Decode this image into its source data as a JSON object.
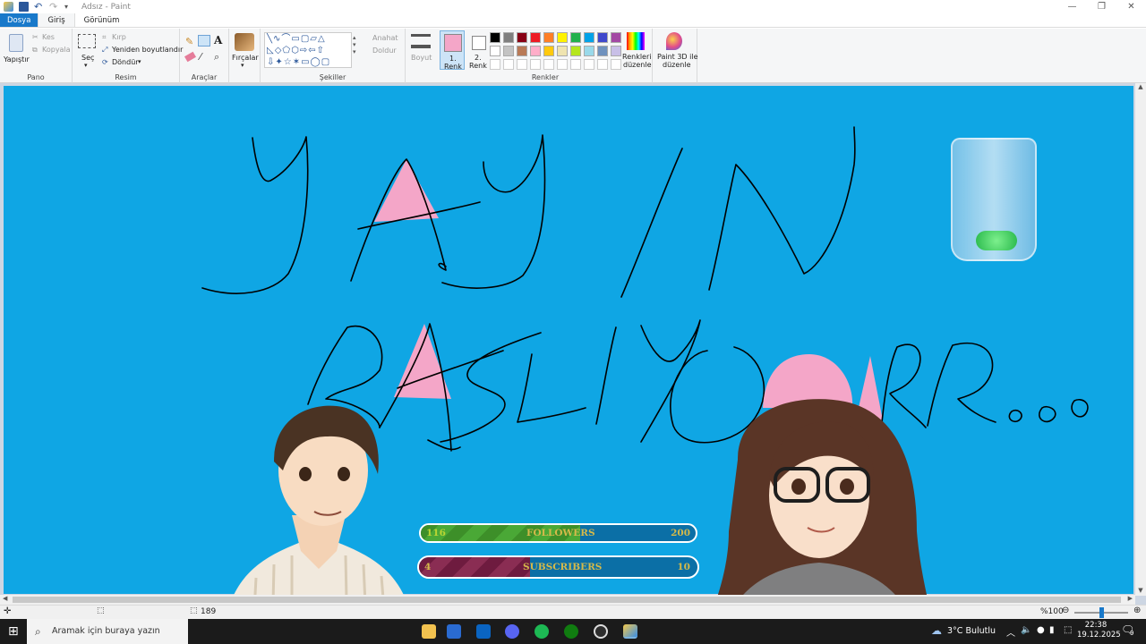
{
  "window": {
    "title": "Adsız - Paint",
    "controls": [
      "minimize-icon",
      "restore-icon",
      "close-icon"
    ]
  },
  "menu": {
    "tabs": [
      "Dosya",
      "Giriş",
      "Görünüm"
    ]
  },
  "ribbon": {
    "pano": {
      "paste_label": "Yapıştır",
      "cut_label": "Kes",
      "copy_label": "Kopyala",
      "group_label": "Pano"
    },
    "resim": {
      "select_label": "Seç",
      "crop_label": "Kırp",
      "resize_label": "Yeniden boyutlandır",
      "rotate_label": "Döndür",
      "group_label": "Resim"
    },
    "araclar": {
      "group_label": "Araçlar"
    },
    "brushes_label": "Fırçalar",
    "sekiller": {
      "outline_label": "Anahat",
      "fill_label": "Doldur",
      "group_label": "Şekiller"
    },
    "size_label": "Boyut",
    "color1": {
      "line1": "1.",
      "line2": "Renk",
      "value": "#f4a6c8"
    },
    "color2": {
      "line1": "2.",
      "line2": "Renk",
      "value": "#ffffff"
    },
    "renkler": {
      "group_label": "Renkler",
      "edit_line1": "Renkleri",
      "edit_line2": "düzenle"
    },
    "paint3d": {
      "line1": "Paint 3D ile",
      "line2": "düzenle"
    },
    "palette_row1": [
      "#000000",
      "#7f7f7f",
      "#880015",
      "#ed1c24",
      "#ff7f27",
      "#fff200",
      "#22b14c",
      "#00a2e8",
      "#3f48cc",
      "#a349a4"
    ],
    "palette_row2": [
      "#ffffff",
      "#c3c3c3",
      "#b97a57",
      "#ffaec9",
      "#ffc90e",
      "#efe4b0",
      "#b5e61d",
      "#99d9ea",
      "#7092be",
      "#c8bfe7"
    ]
  },
  "canvas": {
    "background": "#0fa6e4",
    "drawn_text_line1": "YAYIN",
    "drawn_text_line2": "BAŞLIYOR..."
  },
  "followers": {
    "current": "116",
    "label": "FOLLOWERS",
    "goal": "200",
    "progress": 0.58
  },
  "subscribers": {
    "current": "4",
    "label": "SUBSCRIBERS",
    "goal": "10",
    "progress": 0.4
  },
  "status": {
    "size_text": "189",
    "zoom": "%100"
  },
  "taskbar": {
    "search_placeholder": "Aramak için buraya yazın",
    "weather": "3°C  Bulutlu",
    "time": "22:38",
    "date": "19.12.2025",
    "notif_count": "9"
  }
}
